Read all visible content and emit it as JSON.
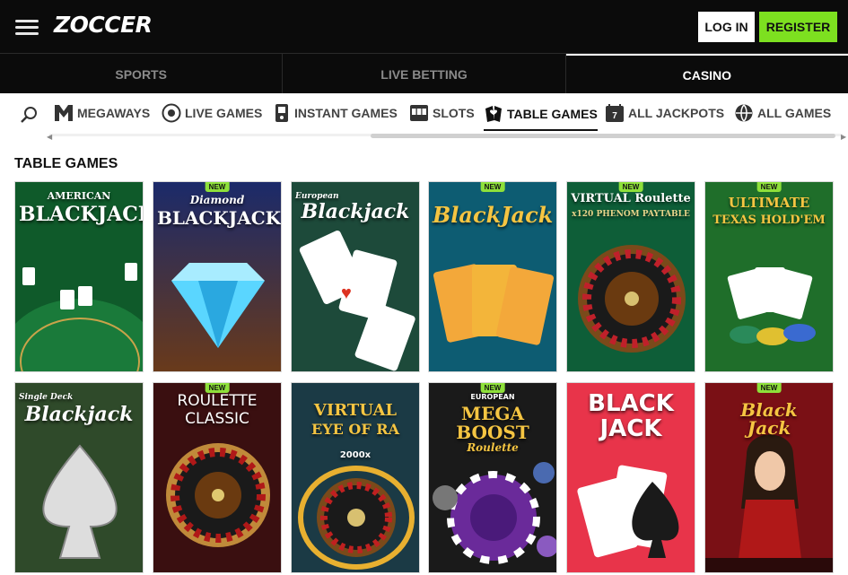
{
  "header": {
    "logo": "ZOCCER",
    "login_label": "LOG IN",
    "register_label": "REGISTER"
  },
  "tabs": [
    {
      "label": "SPORTS",
      "active": false
    },
    {
      "label": "LIVE BETTING",
      "active": false
    },
    {
      "label": "CASINO",
      "active": true
    }
  ],
  "categories": [
    {
      "label": "MEGAWAYS",
      "icon": "megaways-icon"
    },
    {
      "label": "LIVE GAMES",
      "icon": "live-games-icon"
    },
    {
      "label": "INSTANT GAMES",
      "icon": "instant-games-icon"
    },
    {
      "label": "SLOTS",
      "icon": "slots-icon"
    },
    {
      "label": "TABLE GAMES",
      "icon": "table-games-icon",
      "active": true
    },
    {
      "label": "ALL JACKPOTS",
      "icon": "jackpots-icon"
    },
    {
      "label": "ALL GAMES",
      "icon": "all-games-icon"
    }
  ],
  "section": {
    "title": "TABLE GAMES"
  },
  "badge_label": "NEW",
  "games": [
    {
      "title_1": "AMERICAN",
      "title_2": "BLACKJACK",
      "new": false,
      "bg": "#0f5a2a"
    },
    {
      "title_1": "Diamond",
      "title_2": "BLACKJACK",
      "new": true,
      "bg": "#1e2f6e"
    },
    {
      "title_1": "European",
      "title_2": "Blackjack",
      "new": false,
      "bg": "#1d5a3a"
    },
    {
      "title_1": "",
      "title_2": "BlackJack",
      "new": true,
      "bg": "#0d5c72"
    },
    {
      "title_1": "VIRTUAL Roulette",
      "title_2": "x120 PHENOM PAYTABLE",
      "new": true,
      "bg": "#0e5e38"
    },
    {
      "title_1": "ULTIMATE",
      "title_2": "TEXAS HOLD'EM",
      "new": true,
      "bg": "#1f6e2a"
    },
    {
      "title_1": "Single Deck",
      "title_2": "Blackjack",
      "new": false,
      "bg": "#2f4a2a"
    },
    {
      "title_1": "ROULETTE",
      "title_2": "CLASSIC",
      "new": true,
      "bg": "#3a0f10"
    },
    {
      "title_1": "VIRTUAL",
      "title_2": "EYE OF RA",
      "subtitle": "2000x",
      "new": false,
      "bg": "#1b3a45"
    },
    {
      "title_1": "EUROPEAN",
      "title_2": "MEGA BOOST",
      "subtitle": "Roulette",
      "new": true,
      "bg": "#1a1a1a"
    },
    {
      "title_1": "BLACK",
      "title_2": "JACK",
      "new": false,
      "bg": "#e8344a"
    },
    {
      "title_1": "Black",
      "title_2": "Jack",
      "new": true,
      "bg": "#7a1015"
    }
  ],
  "colors": {
    "accent": "#7de020",
    "header_bg": "#0b0b0b"
  }
}
